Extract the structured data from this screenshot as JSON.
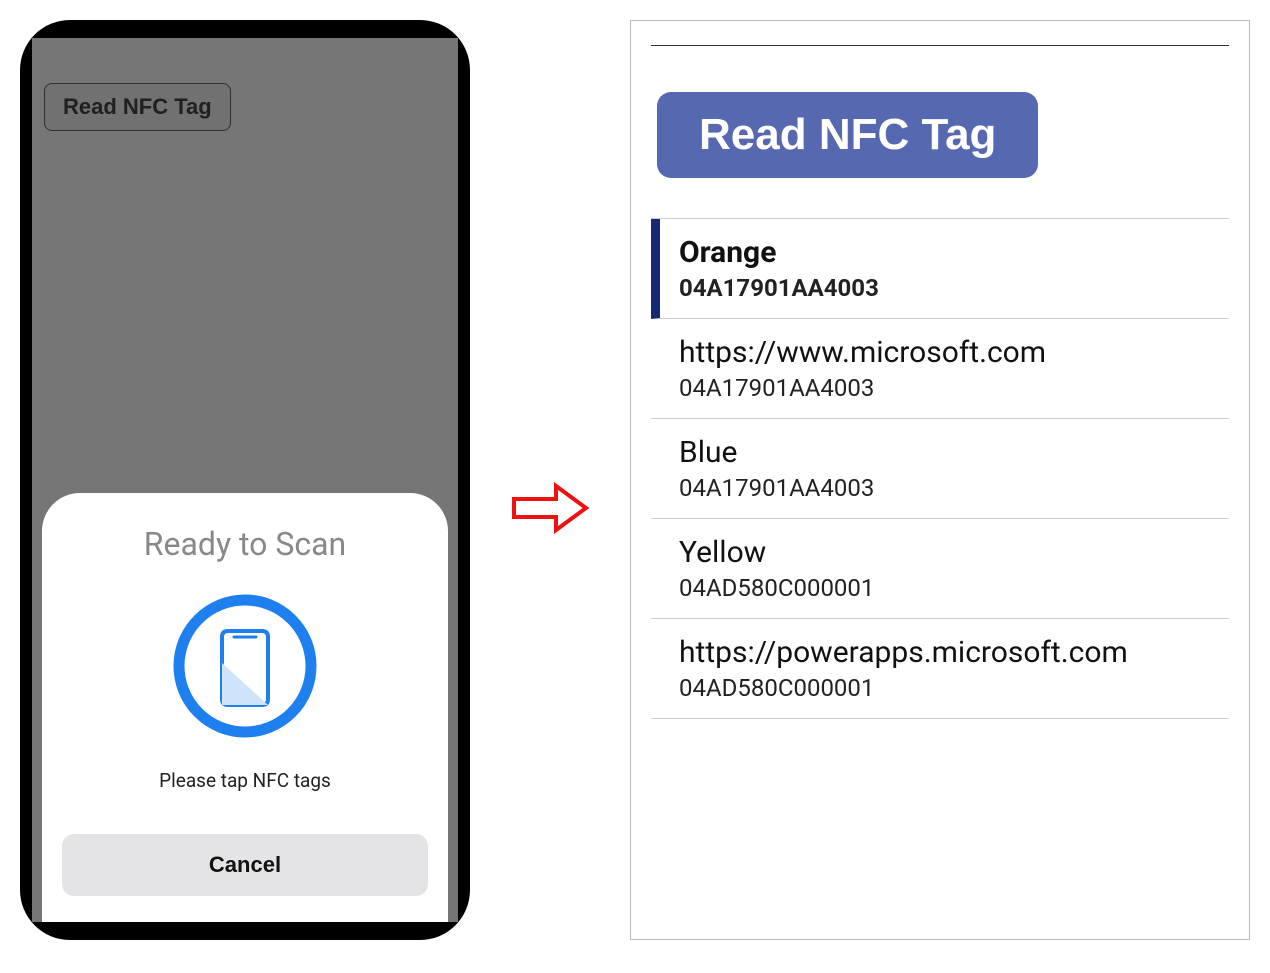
{
  "phone": {
    "button_label": "Read NFC Tag",
    "sheet": {
      "title": "Ready to Scan",
      "subtitle": "Please tap NFC tags",
      "cancel_label": "Cancel"
    }
  },
  "panel": {
    "button_label": "Read NFC Tag",
    "rows": [
      {
        "title": "Orange",
        "subtitle": "04A17901AA4003",
        "selected": true
      },
      {
        "title": "https://www.microsoft.com",
        "subtitle": "04A17901AA4003",
        "selected": false
      },
      {
        "title": "Blue",
        "subtitle": "04A17901AA4003",
        "selected": false
      },
      {
        "title": "Yellow",
        "subtitle": "04AD580C000001",
        "selected": false
      },
      {
        "title": "https://powerapps.microsoft.com",
        "subtitle": "04AD580C000001",
        "selected": false
      }
    ]
  }
}
